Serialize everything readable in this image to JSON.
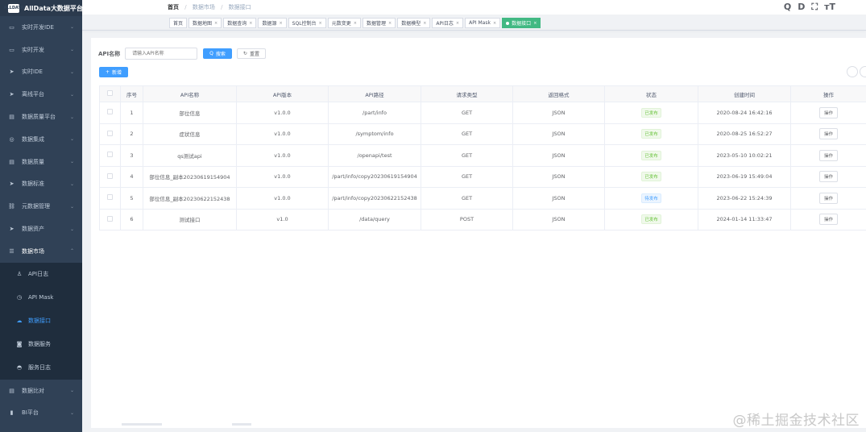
{
  "app": {
    "title": "AllData大数据平台",
    "logo_text": "ALLDATA"
  },
  "sidebar": {
    "items": [
      {
        "label": "实时开发IDE",
        "icon": "monitor-icon",
        "glyph": "▭",
        "arrow": "⌄"
      },
      {
        "label": "实时开发",
        "icon": "monitor-icon",
        "glyph": "▭",
        "arrow": "⌄"
      },
      {
        "label": "实时IDE",
        "icon": "send-icon",
        "glyph": "➤",
        "arrow": "⌄"
      },
      {
        "label": "离线平台",
        "icon": "send-icon",
        "glyph": "➤",
        "arrow": "⌄"
      },
      {
        "label": "数据质量平台",
        "icon": "document-icon",
        "glyph": "▤",
        "arrow": "⌄"
      },
      {
        "label": "数据集成",
        "icon": "target-icon",
        "glyph": "◎",
        "arrow": "⌄"
      },
      {
        "label": "数据质量",
        "icon": "document-icon",
        "glyph": "▤",
        "arrow": "⌄"
      },
      {
        "label": "数据标准",
        "icon": "send-icon",
        "glyph": "➤",
        "arrow": "⌄"
      },
      {
        "label": "元数据管理",
        "icon": "link-icon",
        "glyph": "⛓",
        "arrow": "⌄"
      },
      {
        "label": "数据资产",
        "icon": "send-icon",
        "glyph": "➤",
        "arrow": "⌄"
      },
      {
        "label": "数据市场",
        "icon": "list-icon",
        "glyph": "☰",
        "arrow": "⌃"
      }
    ],
    "sub_items": [
      {
        "label": "API日志",
        "icon": "user-icon",
        "glyph": "♙"
      },
      {
        "label": "API Mask",
        "icon": "clock-icon",
        "glyph": "◷"
      },
      {
        "label": "数据接口",
        "icon": "cloud-icon",
        "glyph": "☁"
      },
      {
        "label": "数据服务",
        "icon": "car-icon",
        "glyph": "◙"
      },
      {
        "label": "服务日志",
        "icon": "bell-icon",
        "glyph": "◓"
      }
    ],
    "bottom_items": [
      {
        "label": "数据比对",
        "icon": "document-icon",
        "glyph": "▤",
        "arrow": "⌄"
      },
      {
        "label": "BI平台",
        "icon": "chart-icon",
        "glyph": "▮",
        "arrow": "⌄"
      }
    ]
  },
  "breadcrumb": {
    "items": [
      "首页",
      "数据市场",
      "数据接口"
    ],
    "sep": "/"
  },
  "header_icons": [
    "Q",
    "D",
    "⛶",
    "ᴛT"
  ],
  "tags": [
    {
      "label": "首页",
      "closable": false
    },
    {
      "label": "数据地图",
      "closable": true
    },
    {
      "label": "数据查询",
      "closable": true
    },
    {
      "label": "数据源",
      "closable": true
    },
    {
      "label": "SQL控制台",
      "closable": true
    },
    {
      "label": "元数变更",
      "closable": true
    },
    {
      "label": "数据管理",
      "closable": true
    },
    {
      "label": "数据模型",
      "closable": true
    },
    {
      "label": "API日志",
      "closable": true
    },
    {
      "label": "API Mask",
      "closable": true
    },
    {
      "label": "数据接口",
      "closable": true,
      "active": true
    }
  ],
  "tag_close": "×",
  "search": {
    "label": "API名称",
    "placeholder": "请输入API名称",
    "search_btn": "搜索",
    "search_glyph": "Q",
    "reset_btn": "重置",
    "reset_glyph": "↻",
    "add_btn": "新增",
    "add_glyph": "+"
  },
  "table": {
    "headers": [
      "",
      "序号",
      "API名称",
      "API版本",
      "API路径",
      "请求类型",
      "返回格式",
      "状态",
      "创建时间",
      "操作"
    ],
    "rows": [
      {
        "no": "1",
        "name": "部位信息",
        "version": "v1.0.0",
        "path": "/part/info",
        "method": "GET",
        "format": "JSON",
        "status": "已发布",
        "status_type": "pub",
        "created": "2020-08-24 16:42:16",
        "op": "操作"
      },
      {
        "no": "2",
        "name": "症状信息",
        "version": "v1.0.0",
        "path": "/symptom/info",
        "method": "GET",
        "format": "JSON",
        "status": "已发布",
        "status_type": "pub",
        "created": "2020-08-25 16:52:27",
        "op": "操作"
      },
      {
        "no": "3",
        "name": "qs测试api",
        "version": "v1.0.0",
        "path": "/openapi/test",
        "method": "GET",
        "format": "JSON",
        "status": "已发布",
        "status_type": "pub",
        "created": "2023-05-10 10:02:21",
        "op": "操作"
      },
      {
        "no": "4",
        "name": "部位信息_副本20230619154904",
        "version": "v1.0.0",
        "path": "/part/info/copy20230619154904",
        "method": "GET",
        "format": "JSON",
        "status": "已发布",
        "status_type": "pub",
        "created": "2023-06-19 15:49:04",
        "op": "操作"
      },
      {
        "no": "5",
        "name": "部位信息_副本20230622152438",
        "version": "v1.0.0",
        "path": "/part/info/copy20230622152438",
        "method": "GET",
        "format": "JSON",
        "status": "待发布",
        "status_type": "unpub",
        "created": "2023-06-22 15:24:39",
        "op": "操作"
      },
      {
        "no": "6",
        "name": "测试接口",
        "version": "v1.0",
        "path": "/data/query",
        "method": "POST",
        "format": "JSON",
        "status": "已发布",
        "status_type": "pub",
        "created": "2024-01-14 11:33:47",
        "op": "操作"
      }
    ]
  },
  "watermark": "@稀土掘金技术社区"
}
